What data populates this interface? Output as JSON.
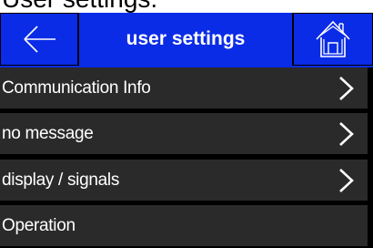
{
  "caption": "User settings:",
  "header": {
    "back_icon": "arrow-left-icon",
    "title": "user settings",
    "home_icon": "home-icon"
  },
  "colors": {
    "header_blue": "#0b2ce6",
    "row_bg": "#2a2a2a",
    "screen_bg": "#000000",
    "text": "#ffffff"
  },
  "menu": {
    "items": [
      {
        "label": "Communication Info",
        "icon": "chevron-right-icon"
      },
      {
        "label": "no message",
        "icon": "chevron-right-icon"
      },
      {
        "label": "display / signals",
        "icon": "chevron-right-icon"
      },
      {
        "label": "Operation",
        "icon": ""
      }
    ]
  }
}
